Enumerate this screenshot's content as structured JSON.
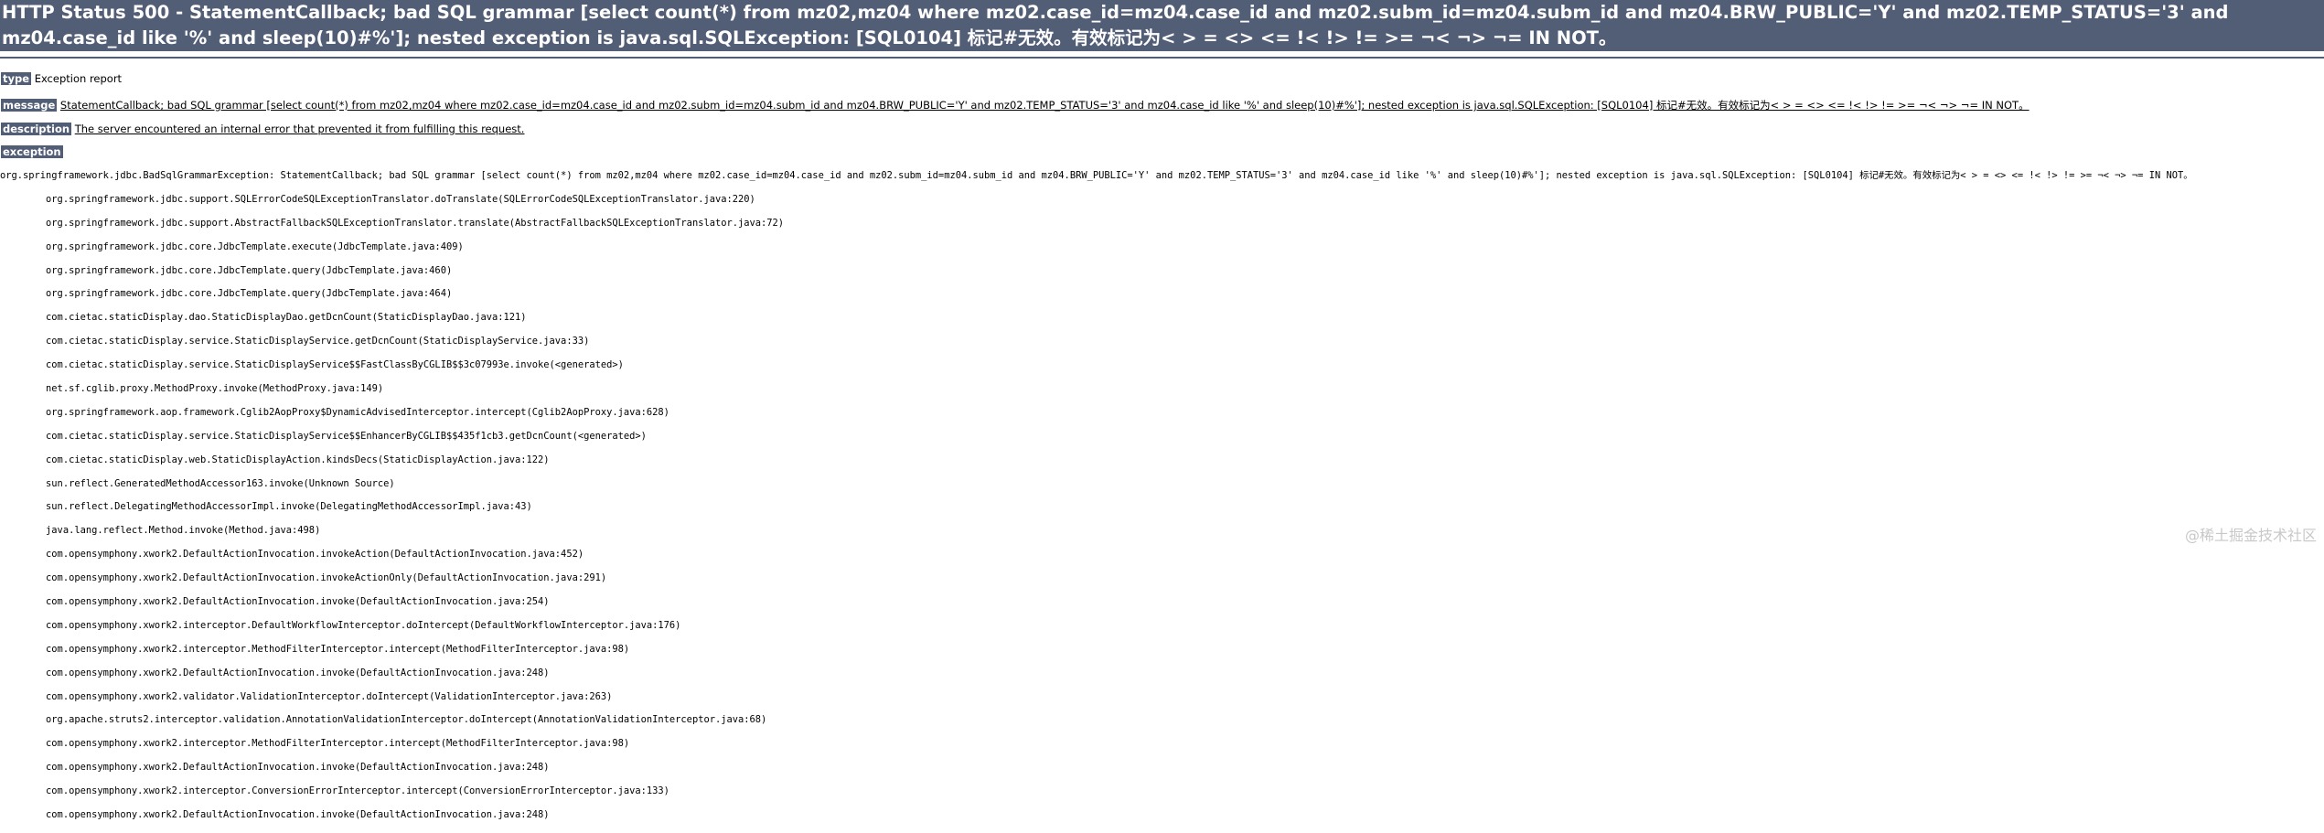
{
  "header": {
    "title": "HTTP Status 500 - StatementCallback; bad SQL grammar [select count(*) from mz02,mz04 where mz02.case_id=mz04.case_id and mz02.subm_id=mz04.subm_id and mz04.BRW_PUBLIC='Y' and mz02.TEMP_STATUS='3' and mz04.case_id like '%' and sleep(10)#%']; nested exception is java.sql.SQLException: [SQL0104] 标记#无效。有效标记为< > = <> <= !< !> != >= ¬< ¬> ¬= IN NOT。"
  },
  "type": {
    "label": "type",
    "value": "Exception report"
  },
  "message": {
    "label": "message",
    "value": "StatementCallback; bad SQL grammar [select count(*) from mz02,mz04 where mz02.case_id=mz04.case_id and mz02.subm_id=mz04.subm_id and mz04.BRW_PUBLIC='Y' and mz02.TEMP_STATUS='3' and mz04.case_id like '%' and sleep(10)#%']; nested exception is java.sql.SQLException: [SQL0104] 标记#无效。有效标记为< > = <> <= !< !> != >= ¬< ¬> ¬= IN NOT。"
  },
  "description": {
    "label": "description",
    "value": "The server encountered an internal error that prevented it from fulfilling this request."
  },
  "exception": {
    "label": "exception"
  },
  "trace": [
    "org.springframework.jdbc.BadSqlGrammarException: StatementCallback; bad SQL grammar [select count(*) from mz02,mz04 where mz02.case_id=mz04.case_id and mz02.subm_id=mz04.subm_id and mz04.BRW_PUBLIC='Y' and mz02.TEMP_STATUS='3' and mz04.case_id like '%' and sleep(10)#%']; nested exception is java.sql.SQLException: [SQL0104] 标记#无效。有效标记为< > = <> <= !< !> != >= ¬< ¬> ¬= IN NOT。",
    "\torg.springframework.jdbc.support.SQLErrorCodeSQLExceptionTranslator.doTranslate(SQLErrorCodeSQLExceptionTranslator.java:220)",
    "\torg.springframework.jdbc.support.AbstractFallbackSQLExceptionTranslator.translate(AbstractFallbackSQLExceptionTranslator.java:72)",
    "\torg.springframework.jdbc.core.JdbcTemplate.execute(JdbcTemplate.java:409)",
    "\torg.springframework.jdbc.core.JdbcTemplate.query(JdbcTemplate.java:460)",
    "\torg.springframework.jdbc.core.JdbcTemplate.query(JdbcTemplate.java:464)",
    "\tcom.cietac.staticDisplay.dao.StaticDisplayDao.getDcnCount(StaticDisplayDao.java:121)",
    "\tcom.cietac.staticDisplay.service.StaticDisplayService.getDcnCount(StaticDisplayService.java:33)",
    "\tcom.cietac.staticDisplay.service.StaticDisplayService$$FastClassByCGLIB$$3c07993e.invoke(<generated>)",
    "\tnet.sf.cglib.proxy.MethodProxy.invoke(MethodProxy.java:149)",
    "\torg.springframework.aop.framework.Cglib2AopProxy$DynamicAdvisedInterceptor.intercept(Cglib2AopProxy.java:628)",
    "\tcom.cietac.staticDisplay.service.StaticDisplayService$$EnhancerByCGLIB$$435f1cb3.getDcnCount(<generated>)",
    "\tcom.cietac.staticDisplay.web.StaticDisplayAction.kindsDecs(StaticDisplayAction.java:122)",
    "\tsun.reflect.GeneratedMethodAccessor163.invoke(Unknown Source)",
    "\tsun.reflect.DelegatingMethodAccessorImpl.invoke(DelegatingMethodAccessorImpl.java:43)",
    "\tjava.lang.reflect.Method.invoke(Method.java:498)",
    "\tcom.opensymphony.xwork2.DefaultActionInvocation.invokeAction(DefaultActionInvocation.java:452)",
    "\tcom.opensymphony.xwork2.DefaultActionInvocation.invokeActionOnly(DefaultActionInvocation.java:291)",
    "\tcom.opensymphony.xwork2.DefaultActionInvocation.invoke(DefaultActionInvocation.java:254)",
    "\tcom.opensymphony.xwork2.interceptor.DefaultWorkflowInterceptor.doIntercept(DefaultWorkflowInterceptor.java:176)",
    "\tcom.opensymphony.xwork2.interceptor.MethodFilterInterceptor.intercept(MethodFilterInterceptor.java:98)",
    "\tcom.opensymphony.xwork2.DefaultActionInvocation.invoke(DefaultActionInvocation.java:248)",
    "\tcom.opensymphony.xwork2.validator.ValidationInterceptor.doIntercept(ValidationInterceptor.java:263)",
    "\torg.apache.struts2.interceptor.validation.AnnotationValidationInterceptor.doIntercept(AnnotationValidationInterceptor.java:68)",
    "\tcom.opensymphony.xwork2.interceptor.MethodFilterInterceptor.intercept(MethodFilterInterceptor.java:98)",
    "\tcom.opensymphony.xwork2.DefaultActionInvocation.invoke(DefaultActionInvocation.java:248)",
    "\tcom.opensymphony.xwork2.interceptor.ConversionErrorInterceptor.intercept(ConversionErrorInterceptor.java:133)",
    "\tcom.opensymphony.xwork2.DefaultActionInvocation.invoke(DefaultActionInvocation.java:248)"
  ],
  "watermark": "@稀土掘金技术社区"
}
